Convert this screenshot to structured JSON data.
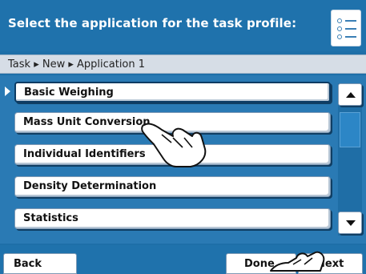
{
  "header": {
    "title": "Select the application for the task profile:",
    "icon": "list-icon"
  },
  "breadcrumb": "Task ▸ New ▸ Application 1",
  "applications": [
    {
      "label": "Basic Weighing",
      "selected": true
    },
    {
      "label": "Mass Unit Conversion",
      "selected": false
    },
    {
      "label": "Individual Identifiers",
      "selected": false
    },
    {
      "label": "Density Determination",
      "selected": false
    },
    {
      "label": "Statistics",
      "selected": false
    }
  ],
  "footer": {
    "back_label": "Back",
    "done_label": "Done",
    "next_label": "Next"
  },
  "colors": {
    "background": "#1e6fa8",
    "header": "#1f72ac",
    "breadcrumb_bar": "#d6dde6",
    "button": "#ffffff"
  }
}
